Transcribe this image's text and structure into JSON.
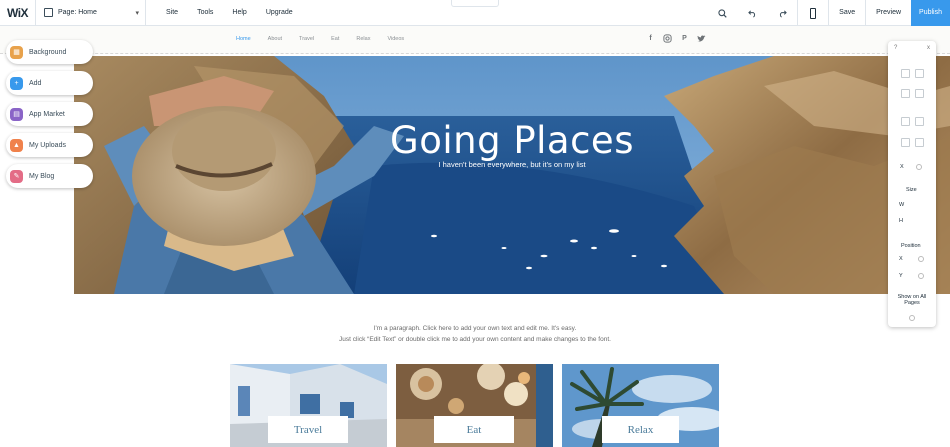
{
  "editor": {
    "logo": "WiX",
    "page_selector": {
      "label": "Page: Home"
    },
    "menu": [
      "Site",
      "Tools",
      "Help",
      "Upgrade"
    ],
    "save_label": "Save",
    "preview_label": "Preview",
    "publish_label": "Publish"
  },
  "site": {
    "nav": [
      "Home",
      "About",
      "Travel",
      "Eat",
      "Relax",
      "Videos"
    ],
    "social_icons": [
      "facebook-icon",
      "instagram-icon",
      "pinterest-icon",
      "twitter-icon"
    ],
    "hero": {
      "title": "Going Places",
      "subtitle": "I haven't been everywhere, but it's on my list"
    },
    "paragraph": {
      "line1": "I'm a paragraph. Click here to add your own text and edit me. It's easy.",
      "line2": "Just click “Edit Text” or double click me to add your own content and make changes to the font."
    },
    "cards": [
      {
        "label": "Travel"
      },
      {
        "label": "Eat"
      },
      {
        "label": "Relax"
      }
    ]
  },
  "left_panel": {
    "items": [
      {
        "label": "Background",
        "icon": "background-icon",
        "color": "#e8a24c"
      },
      {
        "label": "Add",
        "icon": "add-icon",
        "color": "#3899ec"
      },
      {
        "label": "App Market",
        "icon": "app-market-icon",
        "color": "#8a64c7"
      },
      {
        "label": "My Uploads",
        "icon": "upload-icon",
        "color": "#f0824c"
      },
      {
        "label": "My Blog",
        "icon": "blog-icon",
        "color": "#e36c86"
      }
    ]
  },
  "right_panel": {
    "close": "x",
    "help": "?",
    "size_label": "Size",
    "w_label": "W",
    "h_label": "H",
    "position_label": "Position",
    "x_label": "X",
    "y_label": "Y",
    "show_all_pages": "Show on All Pages"
  },
  "colors": {
    "accent": "#3899ec",
    "hero_sky": "#6a9dcf",
    "hero_sea": "#1f4d8a"
  }
}
